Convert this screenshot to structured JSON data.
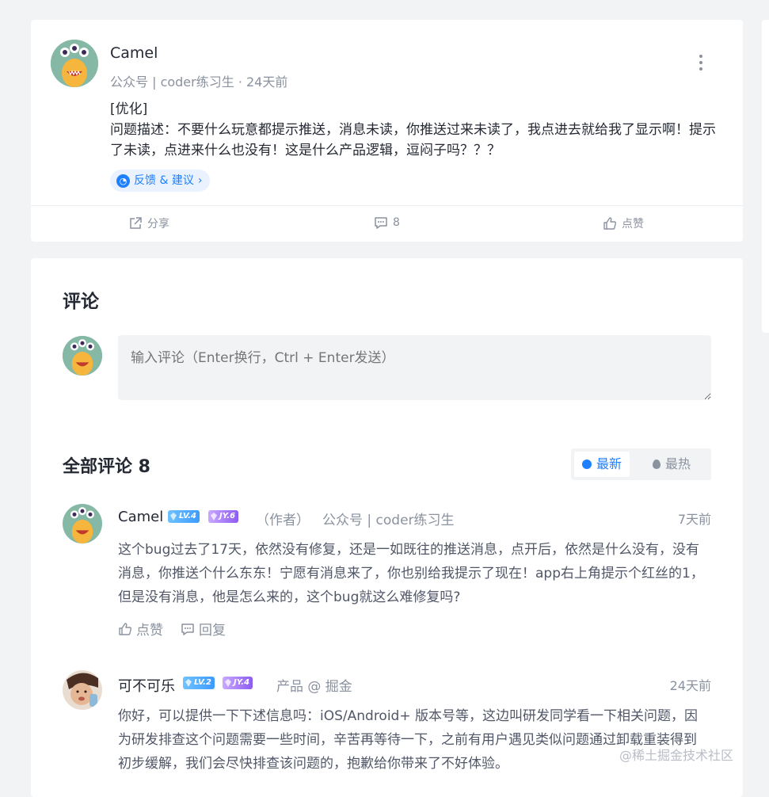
{
  "post": {
    "author": "Camel",
    "meta": "公众号 | coder练习生 · 24天前",
    "body_lines": [
      "[优化]",
      "问题描述：不要什么玩意都提示推送，消息未读，你推送过来未读了，我点进去就给我了显示啊！提示了未读，点进来什么也没有！这是什么产品逻辑，逗闷子吗？？？"
    ],
    "tag": "反馈 & 建议",
    "tag_chevron": "›",
    "share_label": "分享",
    "comment_count": "8",
    "like_label": "点赞"
  },
  "comments_section": {
    "title": "评论",
    "input_placeholder": "输入评论（Enter换行，Ctrl + Enter发送）",
    "all_title": "全部评论 8",
    "sort_new": "最新",
    "sort_hot": "最热"
  },
  "comments": [
    {
      "name": "Camel",
      "level": "LV.4",
      "jy": "JY.6",
      "role": "（作者）",
      "org": "公众号 | coder练习生",
      "time": "7天前",
      "text": "这个bug过去了17天，依然没有修复，还是一如既往的推送消息，点开后，依然是什么没有，没有消息，你推送个什么东东！宁愿有消息来了，你也别给我提示了现在！app右上角提示个红丝的1，但是没有消息，他是怎么来的，这个bug就这么难修复吗?",
      "like_label": "点赞",
      "reply_label": "回复"
    },
    {
      "name": "可不可乐",
      "level": "LV.2",
      "jy": "JY.4",
      "org": "产品 @ 掘金",
      "time": "24天前",
      "text": "你好，可以提供一下下述信息吗：iOS/Android+ 版本号等，这边叫研发同学看一下相关问题，因为研发排查这个问题需要一些时间，辛苦再等待一下，之前有用户遇见类似问题通过卸载重装得到初步缓解，我们会尽快排查该问题的，抱歉给你带来了不好体验。"
    }
  ],
  "watermark": "@稀土掘金技术社区",
  "colors": {
    "accent": "#1e80ff",
    "muted": "#8a919f",
    "avatar_bg": "#85b9a6"
  }
}
